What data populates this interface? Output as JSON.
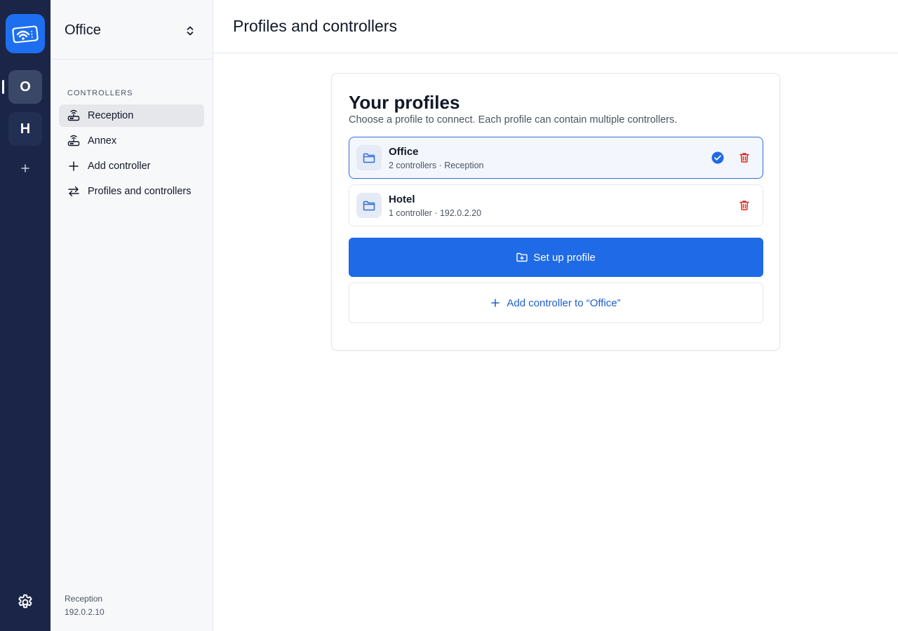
{
  "rail": {
    "logo_icon": "wifi-ticket-icon",
    "workspaces": [
      {
        "initial": "O"
      },
      {
        "initial": "H"
      }
    ],
    "add_icon": "plus-icon",
    "settings_icon": "gear-icon"
  },
  "sidebar": {
    "title": "Office",
    "switch_icon": "chevron-up-down-icon",
    "section_label": "CONTROLLERS",
    "items": [
      {
        "label": "Reception",
        "icon": "router-icon",
        "selected": true
      },
      {
        "label": "Annex",
        "icon": "router-icon"
      },
      {
        "label": "Add controller",
        "icon": "plus-icon"
      },
      {
        "label": "Profiles and controllers",
        "icon": "arrows-swap-icon"
      }
    ],
    "footer": {
      "name": "Reception",
      "address": "192.0.2.10"
    }
  },
  "main": {
    "title": "Profiles and controllers",
    "card": {
      "title": "Your profiles",
      "subtitle": "Choose a profile to connect. Each profile can contain multiple controllers.",
      "profiles": [
        {
          "name": "Office",
          "meta": "2 controllers · Reception",
          "selected": true,
          "icon": "folder-icon"
        },
        {
          "name": "Hotel",
          "meta": "1 controller · 192.0.2.20",
          "selected": false,
          "icon": "folder-icon"
        }
      ],
      "primary_button": "Set up profile",
      "secondary_button": "Add controller to “Office”"
    }
  },
  "colors": {
    "rail_bg": "#1a2547",
    "accent": "#1f6ae6",
    "danger": "#d92d20",
    "link": "#1f5fcf"
  }
}
